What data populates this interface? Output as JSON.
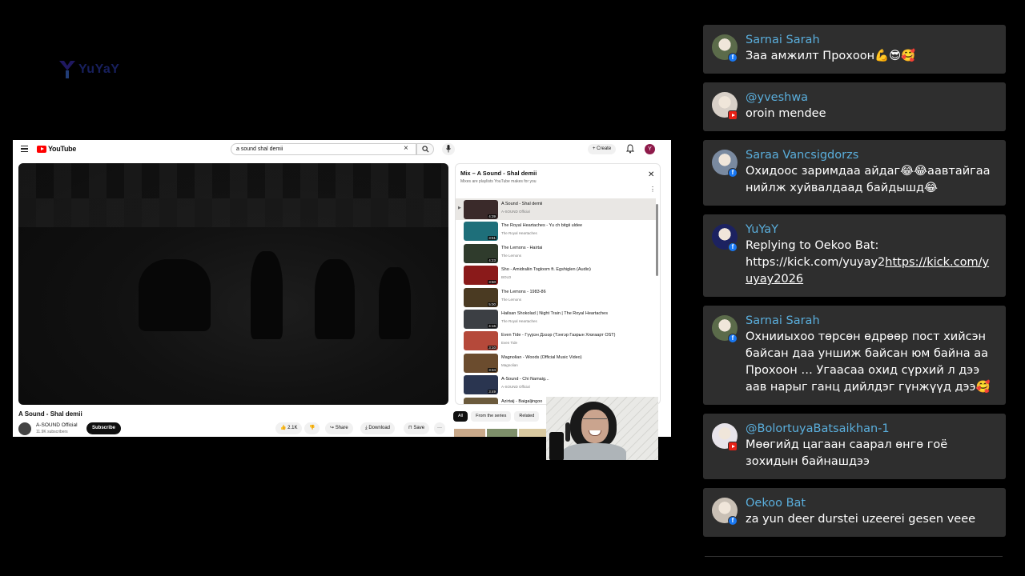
{
  "overlay": {
    "logo_text": "YuYaY"
  },
  "youtube": {
    "logo_text": "YouTube",
    "search": {
      "value": "a sound shal demii"
    },
    "create_label": "Create",
    "avatar_letter": "Y",
    "video": {
      "title": "A Sound - Shal demii",
      "channel": "A-SOUND Official",
      "subscribers": "11.9K subscribers",
      "subscribe_label": "Subscribe",
      "likes": "2.1K",
      "share_label": "Share",
      "download_label": "Download",
      "save_label": "Save",
      "more_label": "···"
    },
    "playlist": {
      "title": "Mix – A Sound - Shal demii",
      "subtitle": "Mixes are playlists YouTube makes for you",
      "items": [
        {
          "title": "A Sound - Shal demii",
          "channel": "A-SOUND Official",
          "duration": "4:39",
          "indicator": "▶",
          "color": "#3a2a2a"
        },
        {
          "title": "The Royal Heartaches - Yu ch bitgii uldee",
          "channel": "The Royal Heartaches",
          "duration": "3:51",
          "indicator": "",
          "color": "#1e6f7a"
        },
        {
          "title": "The Lemons - Hairtai",
          "channel": "The Lemons",
          "duration": "4:23",
          "indicator": "",
          "color": "#2f3b2c"
        },
        {
          "title": "Sho - Amidraliin Togloom ft. Egshiglen (Audio)",
          "channel": "BOLD",
          "duration": "3:50",
          "indicator": "",
          "color": "#8a1a1a"
        },
        {
          "title": "The Lemons - 1983-86",
          "channel": "The Lemons",
          "duration": "5:00",
          "indicator": "",
          "color": "#4a3a22"
        },
        {
          "title": "Hailsan Shokolad | Night Train | The Royal Heartaches",
          "channel": "The Royal Heartaches",
          "duration": "4:16",
          "indicator": "",
          "color": "#3c3f44"
        },
        {
          "title": "Even Tide - Гүүрэн Дэээр (Тэнгэр Газрын Хязгаарт OST)",
          "channel": "Even Tide",
          "duration": "3:10",
          "indicator": "",
          "color": "#b5493a"
        },
        {
          "title": "Magnolian - Woods (Official Music Video)",
          "channel": "Magnolian",
          "duration": "3:34",
          "indicator": "",
          "color": "#6b4c2e"
        },
        {
          "title": "A-Sound - Chi Namaig...",
          "channel": "A-SOUND Official",
          "duration": "3:49",
          "indicator": "",
          "color": "#2a3550"
        },
        {
          "title": "Azirtaij - Baigaljingoo",
          "channel": "",
          "duration": "",
          "indicator": "",
          "color": "#6b5a3c"
        }
      ]
    },
    "chips": [
      "All",
      "From the series",
      "Related"
    ]
  },
  "chat": {
    "messages": [
      {
        "user": "Sarnai Sarah",
        "text": "Заа амжилт Прохоон💪😎🥰",
        "platform": "facebook",
        "avatar_color": "#5b6b4a"
      },
      {
        "user": "@yveshwa",
        "text": "oroin mendee",
        "platform": "youtube",
        "avatar_color": "#d8d0c8"
      },
      {
        "user": "Saraa Vancsigdorzs",
        "text": "Охидоос заримдаа айдаг😂😂аавтайгаа нийлж хуйвалдаад байдышд😂",
        "platform": "facebook",
        "avatar_color": "#7a8aa0"
      },
      {
        "user": "YuYaY",
        "text_prefix": "Replying to Oekoo Bat: https://kick.com/yuyay2",
        "text_link": "https://kick.com/yuyay2026",
        "platform": "facebook",
        "avatar_color": "#1c2260"
      },
      {
        "user": "Sarnai Sarah",
        "text": "Охнииыхоо төрсөн өдрөөр пост хийсэн байсан даа уншиж байсан юм байна аа Прохоон … Угаасаа охид сүрхий л дээ аав нарыг ганц дийлдэг гүнжүүд дээ🥰",
        "platform": "facebook",
        "avatar_color": "#5b6b4a"
      },
      {
        "user": "@BolortuyaBatsaikhan-1",
        "text": "Мөөгийд цагаан саарал өнгө гоё зохидын байнашдээ",
        "platform": "youtube",
        "avatar_color": "#e8e4ea"
      },
      {
        "user": "Oekoo Bat",
        "text": "za yun deer durstei uzeerei gesen veee",
        "platform": "facebook",
        "avatar_color": "#c9c0b5"
      }
    ]
  },
  "colors": {
    "username": "#5aaedc",
    "chat_bg": "#2e2e2e",
    "youtube_red": "#ff0000",
    "facebook_blue": "#1877f2"
  }
}
